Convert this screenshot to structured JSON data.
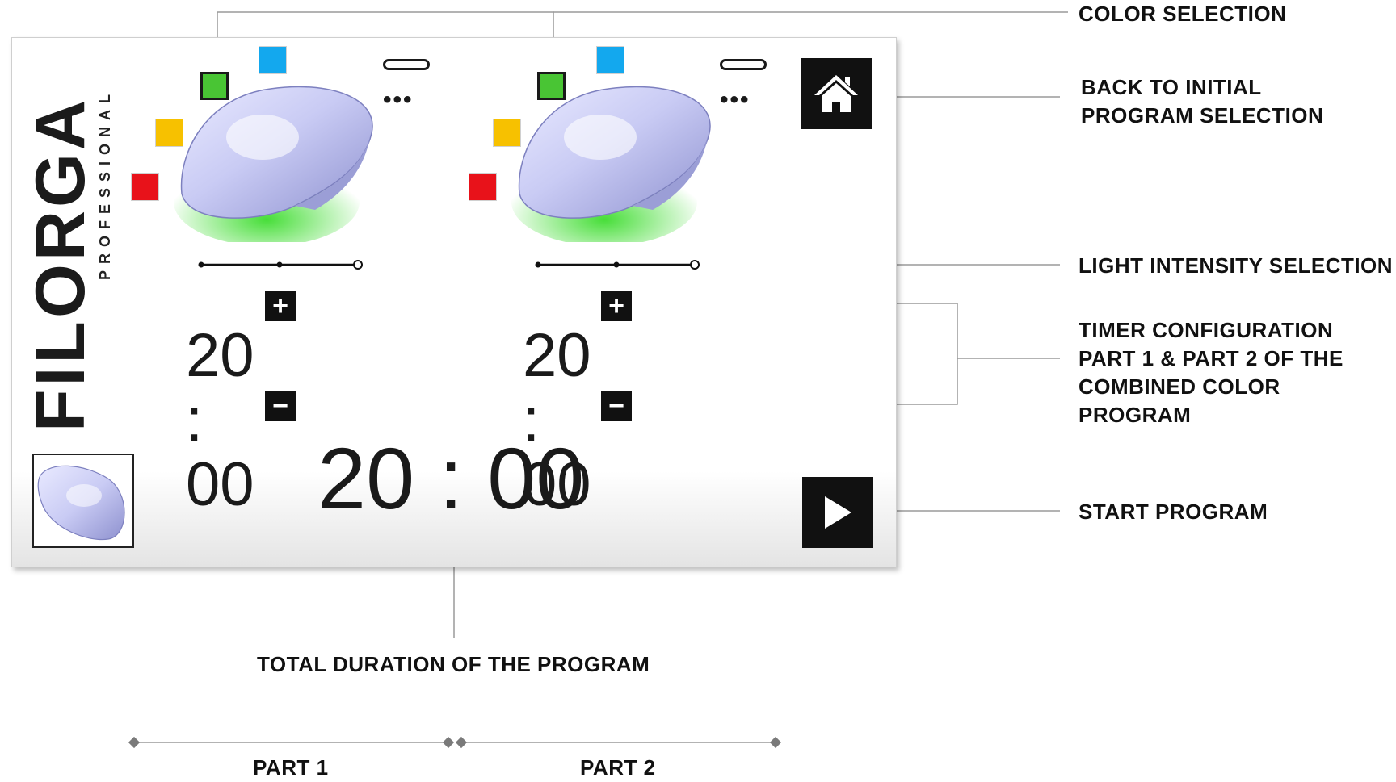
{
  "brand": {
    "name": "FILORGA",
    "subtitle": "PROFESSIONAL"
  },
  "colors": {
    "red": "#e8121a",
    "yellow": "#f7c100",
    "green": "#49c534",
    "blue": "#13a8ee",
    "dark": "#111111",
    "glow": "#3ddc2e",
    "device": "#c9cbf4"
  },
  "parts": [
    {
      "swatch_selected": "green",
      "intensity_level": 1,
      "timer": {
        "minutes": "20",
        "separator": ":",
        "seconds": "00"
      }
    },
    {
      "swatch_selected": "green",
      "intensity_level": 1,
      "timer": {
        "minutes": "20",
        "separator": ":",
        "seconds": "00"
      }
    }
  ],
  "total": {
    "minutes": "20",
    "separator": ":",
    "seconds": "00"
  },
  "buttons": {
    "plus_label": "+",
    "minus_label": "−",
    "home_icon": "home-icon",
    "play_icon": "play-icon"
  },
  "callouts": {
    "color_selection": "COLOR SELECTION",
    "back_line1": "BACK TO INITIAL",
    "back_line2": "PROGRAM SELECTION",
    "intensity": "LIGHT INTENSITY SELECTION",
    "timer_line1": "TIMER CONFIGURATION",
    "timer_line2": "PART 1 & PART 2 OF THE",
    "timer_line3": "COMBINED COLOR PROGRAM",
    "start": "START PROGRAM",
    "total_duration": "TOTAL DURATION OF THE PROGRAM",
    "part1": "PART 1",
    "part2": "PART 2"
  }
}
